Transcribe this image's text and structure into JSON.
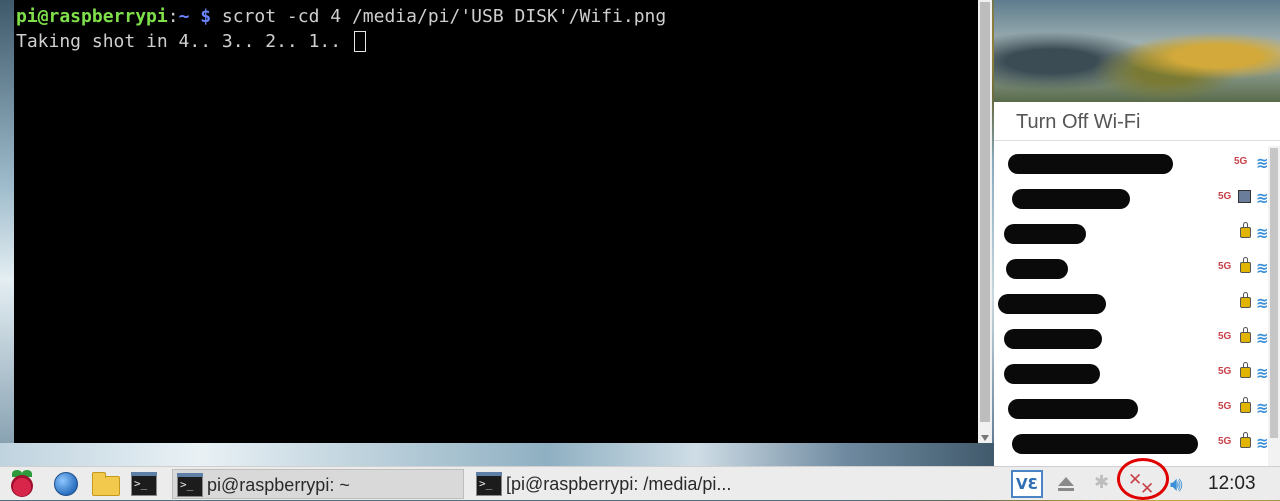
{
  "terminal": {
    "prompt_user": "pi@raspberrypi",
    "prompt_sep": ":",
    "prompt_path": "~ $",
    "command": " scrot -cd 4 /media/pi/'USB DISK'/Wifi.png",
    "output": "Taking shot in 4.. 3.. 2.. 1.. "
  },
  "wifi_menu": {
    "toggle_label": "Turn Off Wi-Fi",
    "networks": [
      {
        "ssid_redacted": true,
        "band": "5G",
        "secured": false,
        "enterprise": false
      },
      {
        "ssid_redacted": true,
        "band": "5G",
        "secured": false,
        "enterprise": true
      },
      {
        "ssid_redacted": true,
        "band": "",
        "secured": true,
        "enterprise": false
      },
      {
        "ssid_redacted": true,
        "band": "5G",
        "secured": true,
        "enterprise": false
      },
      {
        "ssid_redacted": true,
        "band": "",
        "secured": true,
        "enterprise": false
      },
      {
        "ssid_redacted": true,
        "band": "5G",
        "secured": true,
        "enterprise": false
      },
      {
        "ssid_redacted": true,
        "band": "5G",
        "secured": true,
        "enterprise": false
      },
      {
        "ssid_redacted": true,
        "band": "5G",
        "secured": true,
        "enterprise": false
      },
      {
        "ssid_redacted": true,
        "band": "5G",
        "secured": true,
        "enterprise": false
      }
    ]
  },
  "taskbar": {
    "tasks": [
      {
        "label": "pi@raspberrypi: ~",
        "active": true
      },
      {
        "label": "[pi@raspberrypi: /media/pi...",
        "active": false
      }
    ],
    "tray": {
      "vnc_label": "VƐ",
      "clock": "12:03"
    },
    "icons": [
      "raspberry-menu-icon",
      "web-browser-icon",
      "file-manager-icon",
      "terminal-icon",
      "vnc-icon",
      "eject-icon",
      "bluetooth-icon",
      "wifi-disconnected-icon",
      "volume-icon"
    ]
  },
  "term_glyph": ">_"
}
